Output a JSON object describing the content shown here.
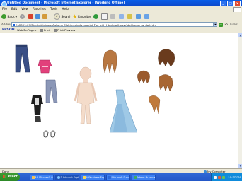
{
  "window": {
    "title": "Untitled Document - Microsoft Internet Explorer - [Working Offline]"
  },
  "menu": [
    "File",
    "Edit",
    "View",
    "Favorites",
    "Tools",
    "Help"
  ],
  "toolbar": {
    "back": "Back",
    "search": "Search",
    "favorites": "Favorites"
  },
  "address": {
    "label": "Address",
    "value": "E:\\2009-09\\Student\\leisure\\Autumn Multimedia\\Javascript Fun with Html\\dollhouse\\dollhouse up doll.htm",
    "go": "Go",
    "links": "Links"
  },
  "epson": {
    "logo": "EPSON",
    "web_to_page": "Web-To-Page",
    "print": "Print",
    "print_preview": "Print Preview"
  },
  "status": {
    "text": "Done",
    "zone": "My Computer"
  },
  "taskbar": {
    "start": "start",
    "tasks": [
      {
        "label": "10 Microsoft Cu..."
      },
      {
        "label": "3 Internet Expl..."
      },
      {
        "label": "4 Windows Exp..."
      },
      {
        "label": "Microsoft Front..."
      },
      {
        "label": "Adobe Dreamv..."
      }
    ],
    "clock": "11:37 PM"
  },
  "colors": {
    "titlebar": "#0d47c8",
    "chrome": "#ece9d8",
    "taskbar": "#2458c8",
    "start": "#2e8a28",
    "tray": "#0f8bdb"
  }
}
